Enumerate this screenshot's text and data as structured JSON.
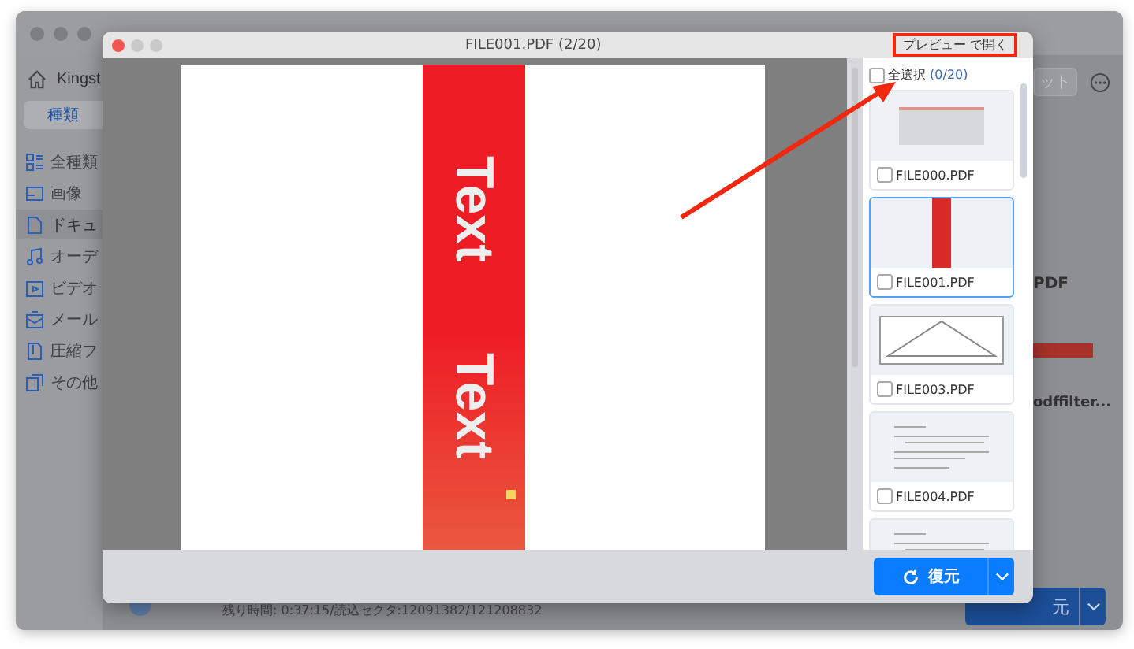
{
  "background_window": {
    "app_name": "Kingst",
    "tab": "種類",
    "sidebar": [
      {
        "label": "全種類",
        "kind": "grid",
        "selected": false
      },
      {
        "label": "画像",
        "kind": "image",
        "selected": false
      },
      {
        "label": "ドキュ",
        "kind": "document",
        "selected": true
      },
      {
        "label": "オーデ",
        "kind": "audio",
        "selected": false
      },
      {
        "label": "ビデオ",
        "kind": "video",
        "selected": false
      },
      {
        "label": "メール",
        "kind": "mail",
        "selected": false
      },
      {
        "label": "圧縮フ",
        "kind": "archive",
        "selected": false
      },
      {
        "label": "その他",
        "kind": "other",
        "selected": false
      }
    ],
    "toolbar_button": "ット",
    "file_label": "PDF",
    "file_name": "odffilter...",
    "status_text": "残り時間: 0:37:15/読込セクタ:12091382/121208832",
    "recover_button": "元"
  },
  "preview": {
    "title": "FILE001.PDF (2/20)",
    "open_button": "プレビュー で開く",
    "page_texts": [
      "Text",
      "Text"
    ],
    "select_all": {
      "label": "全選択",
      "count": "(0/20)",
      "checked": false
    },
    "files": [
      {
        "name": "FILE000.PDF",
        "kind": "screen",
        "checked": false,
        "selected": false
      },
      {
        "name": "FILE001.PDF",
        "kind": "banner",
        "checked": false,
        "selected": true
      },
      {
        "name": "FILE003.PDF",
        "kind": "triangle",
        "checked": false,
        "selected": false
      },
      {
        "name": "FILE004.PDF",
        "kind": "text",
        "checked": false,
        "selected": false
      },
      {
        "kind": "text",
        "selected": false
      }
    ],
    "recover_button": "復元"
  }
}
